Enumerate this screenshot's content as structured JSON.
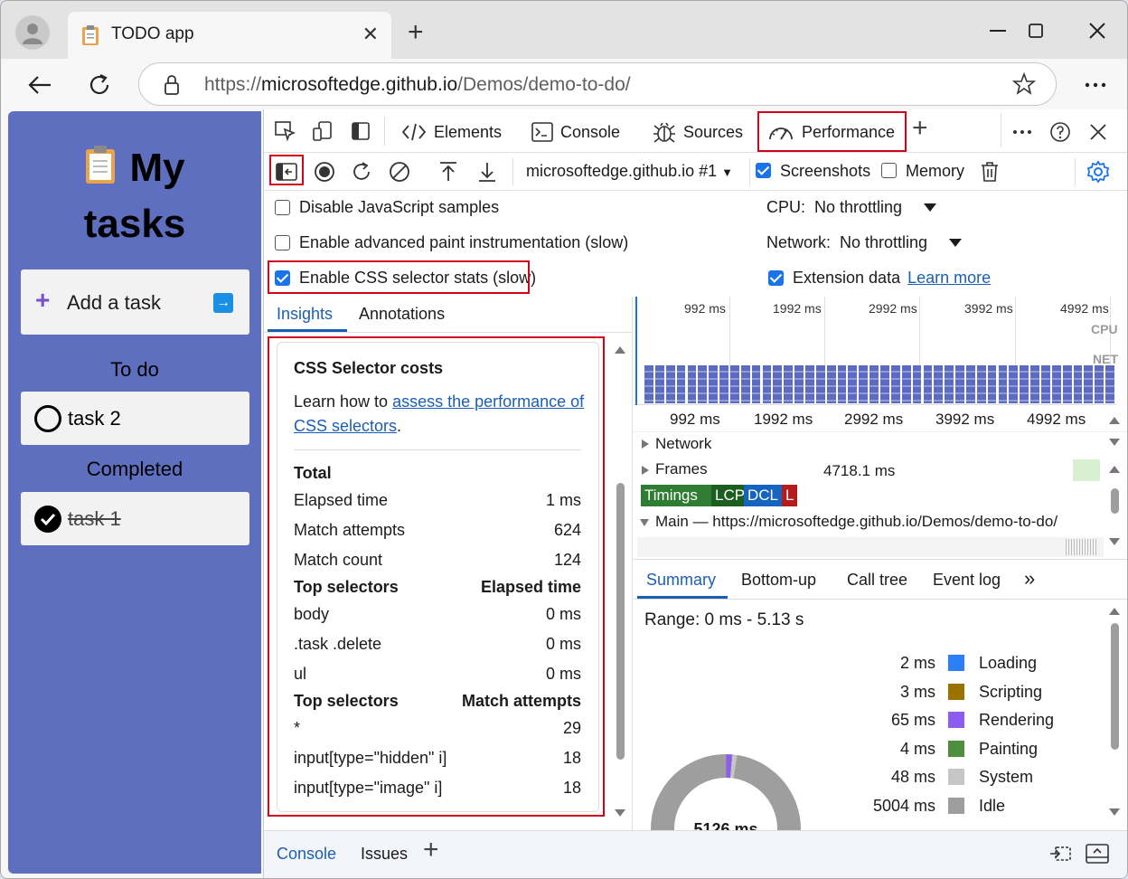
{
  "browser": {
    "tab_title": "TODO app",
    "url_prefix": "https://",
    "url_host": "microsoftedge.github.io",
    "url_path": "/Demos/demo-to-do/"
  },
  "app": {
    "title_line1": "My",
    "title_line2": "tasks",
    "add_task_label": "Add a task",
    "todo_heading": "To do",
    "completed_heading": "Completed",
    "todo_tasks": [
      "task 2"
    ],
    "completed_tasks": [
      "task 1"
    ]
  },
  "devtools": {
    "tabs": {
      "elements": "Elements",
      "console": "Console",
      "sources": "Sources",
      "performance": "Performance"
    },
    "toolbar": {
      "target": "microsoftedge.github.io #1",
      "screenshots": "Screenshots",
      "memory": "Memory"
    },
    "settings": {
      "disable_js": "Disable JavaScript samples",
      "adv_paint": "Enable advanced paint instrumentation (slow)",
      "css_stats": "Enable CSS selector stats (slow)",
      "cpu_label": "CPU:",
      "cpu_value": "No throttling",
      "network_label": "Network:",
      "network_value": "No throttling",
      "extension_data": "Extension data",
      "learn_more": "Learn more"
    },
    "insights": {
      "tab_insights": "Insights",
      "tab_annotations": "Annotations",
      "card_title": "CSS Selector costs",
      "desc_prefix": "Learn how to ",
      "desc_link": "assess the performance of CSS selectors",
      "desc_suffix": ".",
      "total_label": "Total",
      "metrics": [
        {
          "label": "Elapsed time",
          "value": "1 ms"
        },
        {
          "label": "Match attempts",
          "value": "624"
        },
        {
          "label": "Match count",
          "value": "124"
        }
      ],
      "top_elapsed_header": {
        "left": "Top selectors",
        "right": "Elapsed time"
      },
      "top_elapsed": [
        {
          "label": "body",
          "value": "0 ms"
        },
        {
          "label": ".task .delete",
          "value": "0 ms"
        },
        {
          "label": "ul",
          "value": "0 ms"
        }
      ],
      "top_attempts_header": {
        "left": "Top selectors",
        "right": "Match attempts"
      },
      "top_attempts": [
        {
          "label": "*",
          "value": "29"
        },
        {
          "label": "input[type=\"hidden\" i]",
          "value": "18"
        },
        {
          "label": "input[type=\"image\" i]",
          "value": "18"
        }
      ]
    },
    "timeline": {
      "overview_ticks": [
        "992 ms",
        "1992 ms",
        "2992 ms",
        "3992 ms",
        "4992 ms"
      ],
      "cpu_label": "CPU",
      "net_label": "NET",
      "ruler_ticks": [
        "992 ms",
        "1992 ms",
        "2992 ms",
        "3992 ms",
        "4992 ms"
      ],
      "network_track": "Network",
      "frames_track": "Frames",
      "frames_value": "4718.1 ms",
      "timings_track": "Timings",
      "markers": {
        "lcp": "LCP",
        "dcl": "DCL",
        "l": "L"
      },
      "main_track": "Main — https://microsoftedge.github.io/Demos/demo-to-do/"
    },
    "summary": {
      "tabs": [
        "Summary",
        "Bottom-up",
        "Call tree",
        "Event log"
      ],
      "range": "Range: 0 ms - 5.13 s",
      "total": "5126 ms",
      "legend": [
        {
          "value": "2 ms",
          "name": "Loading",
          "color": "#2d7ff9",
          "ms": 2
        },
        {
          "value": "3 ms",
          "name": "Scripting",
          "color": "#9a7204",
          "ms": 3
        },
        {
          "value": "65 ms",
          "name": "Rendering",
          "color": "#8c5cf0",
          "ms": 65
        },
        {
          "value": "4 ms",
          "name": "Painting",
          "color": "#4e8e3f",
          "ms": 4
        },
        {
          "value": "48 ms",
          "name": "System",
          "color": "#c6c6c6",
          "ms": 48
        },
        {
          "value": "5004 ms",
          "name": "Idle",
          "color": "#9e9e9e",
          "ms": 5004
        }
      ]
    },
    "drawer": {
      "console": "Console",
      "issues": "Issues"
    }
  }
}
